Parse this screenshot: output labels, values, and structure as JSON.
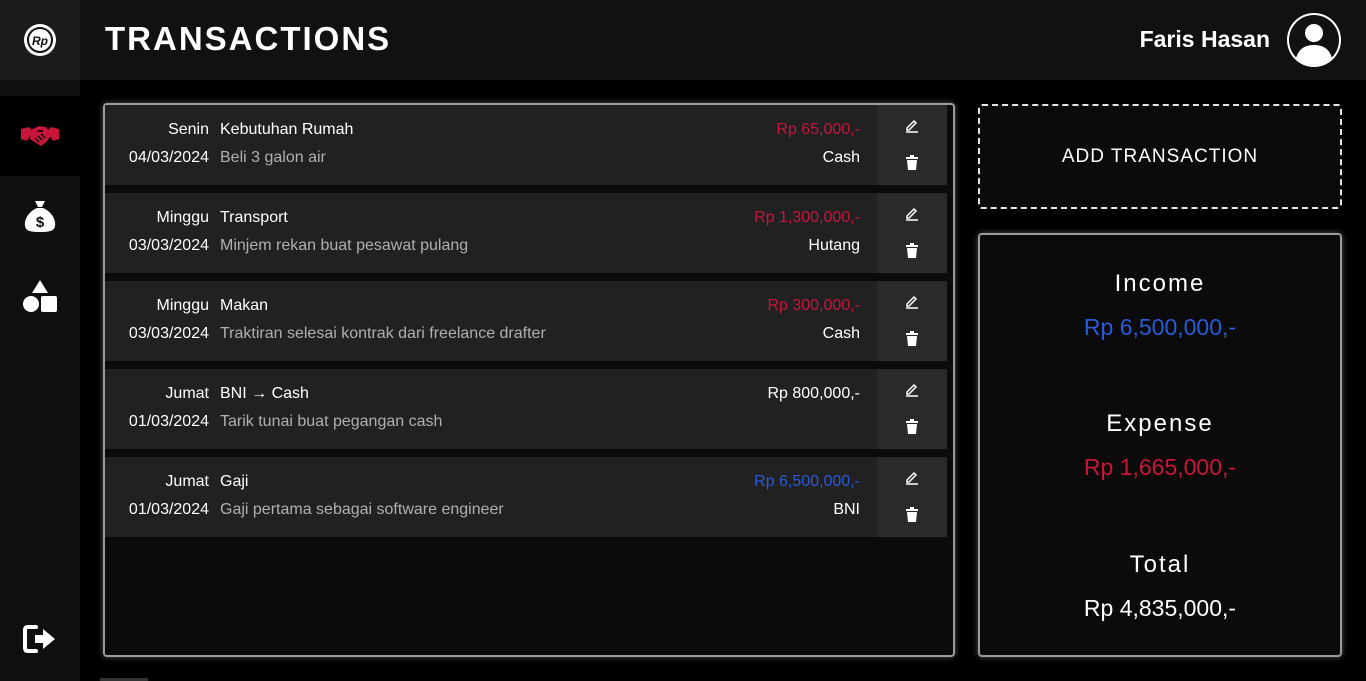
{
  "app": {
    "logo_text": "Rp"
  },
  "header": {
    "title": "TRANSACTIONS",
    "user_name": "Faris Hasan"
  },
  "sidebar": {
    "items": [
      {
        "icon": "handshake-icon",
        "active": true,
        "color": "#c8163a"
      },
      {
        "icon": "money-bag-icon",
        "active": false
      },
      {
        "icon": "shapes-icon",
        "active": false
      }
    ],
    "logout_icon": "logout-icon"
  },
  "transactions": [
    {
      "day": "Senin",
      "date": "04/03/2024",
      "category": "Kebutuhan Rumah",
      "description": "Beli 3 galon air",
      "amount": "Rp 65,000,-",
      "type": "expense",
      "account": "Cash"
    },
    {
      "day": "Minggu",
      "date": "03/03/2024",
      "category": "Transport",
      "description": "Minjem rekan buat pesawat pulang",
      "amount": "Rp 1,300,000,-",
      "type": "expense",
      "account": "Hutang"
    },
    {
      "day": "Minggu",
      "date": "03/03/2024",
      "category": "Makan",
      "description": "Traktiran selesai kontrak dari freelance drafter",
      "amount": "Rp 300,000,-",
      "type": "expense",
      "account": "Cash"
    },
    {
      "day": "Jumat",
      "date": "01/03/2024",
      "category": "BNI → Cash",
      "description": "Tarik tunai buat pegangan cash",
      "amount": "Rp 800,000,-",
      "type": "transfer",
      "account": ""
    },
    {
      "day": "Jumat",
      "date": "01/03/2024",
      "category": "Gaji",
      "description": "Gaji pertama sebagai software engineer",
      "amount": "Rp 6,500,000,-",
      "type": "income",
      "account": "BNI"
    }
  ],
  "add_button": {
    "label": "ADD TRANSACTION"
  },
  "summary": {
    "income_label": "Income",
    "income_value": "Rp 6,500,000,-",
    "expense_label": "Expense",
    "expense_value": "Rp 1,665,000,-",
    "total_label": "Total",
    "total_value": "Rp 4,835,000,-"
  },
  "colors": {
    "expense": "#c8163a",
    "income": "#2b5ad6",
    "transfer": "#ffffff"
  }
}
